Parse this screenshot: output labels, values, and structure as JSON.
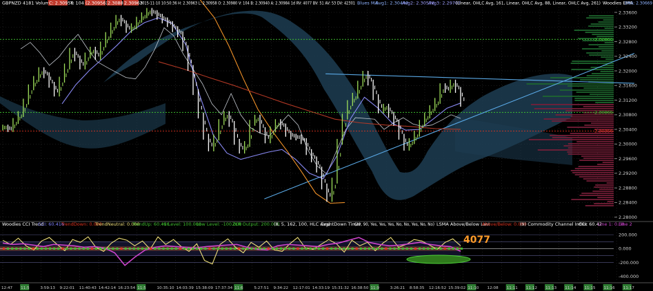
{
  "header": {
    "symbol": "GBPNZD",
    "period": "4181",
    "volume_label": "Volume #2",
    "c_label": "C: 2.30956",
    "t_label": "T: 104",
    "red_badges": [
      "(2.30956)",
      "2.30881",
      "2.30963"
    ],
    "bar_info": "2015-11-10 10:50:36 H: 2.30963 L: 2.30958 O: 2.30980 V: 104 B: 2.30940 A: 2.30984 1d RV: 4077 BV: 51 AV: 53 DV: 42301",
    "blues_ma_label": "Blues MA",
    "avg1": "Avg1: 2.30440",
    "avg2": "Avg2: 2.30576",
    "avg3": "Avg3: 2.29707",
    "ma_params": "(Linear, OHLC Avg, 161, Linear, OHLC Avg, 88, Linear, OHLC Avg, 261)",
    "woodies_ema": "Woodies EMA",
    "ema_value": "EMA: 2.30669"
  },
  "indicator_header": {
    "title": "Woodies CCI Trend",
    "cci": "CCI: 60.416",
    "trend_down": "TrendDown: 0.000",
    "trend_neutral": "TrendNeutral: 0.000",
    "trend_up": "TrendUp: 60.416",
    "hi_level": "Hi Level: 100.000",
    "low_level": "Low Level: -100.000",
    "zlr": "ZLR Output: 200.000",
    "params": "(8, 5, 162, 100, HLC Avg)",
    "countdown": "CountDown Timer",
    "countdown_params": "(20, 90, Yes, Yes, Yes, No, No, Yes, No, No)",
    "lsma": "LSMA Above/Below Last",
    "lsma_value": "Above/Below: 0.000",
    "cci_name": "(9)  Commodity Channel Index",
    "cci2": "CCI: 60.42",
    "line1": "Line 1: 0.00",
    "line2": "Line 2"
  },
  "big_label": "4077",
  "colors": {
    "background": "#000000",
    "grid": "#333333",
    "price_up": "#9fe05a",
    "price_down": "#ffffff",
    "band_fill": "#1d3d52",
    "level_green": "#3fbf2f",
    "level_red": "#e0331f",
    "trendline": "#5aa9e6",
    "cci_line": "#f0e07a",
    "cci_trend": "#cc44cc",
    "big_label": "#ff9c2a",
    "zero_band": "#a0522d"
  },
  "chart_data": [
    {
      "type": "line",
      "title": "",
      "ylim": [
        2.279,
        2.3375
      ],
      "yticks": [
        "2.33600",
        "2.33200",
        "2.32800",
        "2.32400",
        "2.32000",
        "2.31600",
        "2.31200",
        "2.30800",
        "2.30400",
        "2.30000",
        "2.29600",
        "2.29200",
        "2.28800",
        "2.28400",
        "2.28000"
      ],
      "ytick_values": [
        2.336,
        2.332,
        2.328,
        2.324,
        2.32,
        2.316,
        2.312,
        2.308,
        2.304,
        2.3,
        2.296,
        2.292,
        2.288,
        2.284,
        2.28
      ],
      "xticks": [
        "12:47",
        "11:5",
        "3:59:13",
        "9:22:01",
        "11:40:43",
        "14:42:14",
        "16:23:54",
        "11:5",
        "10:35:10",
        "14:03:39",
        "15:38:09",
        "17:37:34",
        "11:6",
        "5:27:51",
        "9:34:22",
        "12:17:01",
        "14:33:19",
        "15:31:32",
        "16:38:50",
        "11:9",
        "3:26:21",
        "8:58:35",
        "12:16:52",
        "15:39:02",
        "11:10",
        "12:08",
        "11:11",
        "11:12",
        "11:13",
        "11:14",
        "11:15",
        "11:16",
        "11:17"
      ],
      "price_labels": [
        {
          "text": "2.32861",
          "value": 2.32861,
          "color": "#3fbf2f"
        },
        {
          "text": "2.30865",
          "value": 2.30865,
          "color": "#3fbf2f"
        },
        {
          "text": "2.30356",
          "value": 2.30356,
          "color": "#e0331f"
        }
      ],
      "horizontal_levels": [
        {
          "value": 2.32861,
          "color": "#3fbf2f"
        },
        {
          "value": 2.30865,
          "color": "#3fbf2f"
        },
        {
          "value": 2.30356,
          "color": "#e0331f"
        }
      ],
      "series": [
        {
          "kind": "price",
          "values": [
            2.3045,
            2.3041,
            2.3063,
            2.3082,
            2.3116,
            2.3155,
            2.3178,
            2.3202,
            2.3188,
            2.3162,
            2.3138,
            2.3176,
            2.3212,
            2.3255,
            2.3234,
            2.3212,
            2.3242,
            2.3258,
            2.3238,
            2.3272,
            2.3298,
            2.3324,
            2.3345,
            2.333,
            2.3312,
            2.3322,
            2.334,
            2.3352,
            2.3364,
            2.3358,
            2.3348,
            2.3338,
            2.3328,
            2.3314,
            2.33,
            2.3262,
            2.3208,
            2.3142,
            2.3078,
            2.302,
            2.2988,
            2.3018,
            2.306,
            2.3082,
            2.3055,
            2.3006,
            2.2982,
            2.3,
            2.3058,
            2.3072,
            2.3038,
            2.301,
            2.304,
            2.306,
            2.3048,
            2.3028,
            2.302,
            2.3018,
            2.3008,
            2.2978,
            2.2958,
            2.293,
            2.2884,
            2.285,
            2.29,
            2.3006,
            2.3075,
            2.3112,
            2.3132,
            2.3165,
            2.3192,
            2.3168,
            2.3128,
            2.3092,
            2.3102,
            2.308,
            2.3058,
            2.302,
            2.299,
            2.3008,
            2.3028,
            2.3058,
            2.3078,
            2.3098,
            2.3118,
            2.3158,
            2.3148,
            2.3168,
            2.3148,
            2.311
          ],
          "color": "#9fe05a"
        },
        {
          "kind": "white-line",
          "values": [
            2.326,
            2.3278,
            2.325,
            2.3215,
            2.3238,
            2.3272,
            2.33,
            2.326,
            2.3225,
            2.321,
            2.3196,
            2.3182,
            2.3178,
            2.321,
            2.3258,
            2.3318,
            2.3296,
            2.3246,
            2.3205,
            2.3165,
            2.311,
            2.308,
            2.3138,
            2.308,
            2.3045,
            2.303,
            2.3022,
            2.3052,
            2.308,
            2.3052,
            2.2985,
            2.294,
            2.2918,
            2.298,
            2.304,
            2.3072,
            2.307,
            2.3068,
            2.304,
            2.3058,
            2.3072,
            2.3055,
            2.3048,
            2.3052,
            2.3065,
            2.308,
            2.307
          ],
          "color": "#cfd4dc"
        },
        {
          "kind": "blue-ma",
          "values": [
            2.311,
            2.3162,
            2.3202,
            2.3235,
            2.327,
            2.3308,
            2.3332,
            2.3345,
            2.333,
            2.3272,
            2.3135,
            2.3025,
            2.2975,
            2.2958,
            2.2968,
            2.2978,
            2.2985,
            2.2958,
            2.292,
            2.2905,
            2.2968,
            2.307,
            2.3128,
            2.3098,
            2.3058,
            2.3038,
            2.304,
            2.3068,
            2.3098,
            2.3112
          ],
          "color": "#8f8fff"
        },
        {
          "kind": "orange-ma",
          "values": [
            2.3395,
            2.3345,
            2.3268,
            2.3178,
            2.3095,
            2.3035,
            2.2982,
            2.2925,
            2.2865,
            2.2838,
            2.284
          ],
          "color": "#ff9a2a"
        },
        {
          "kind": "red-ma",
          "values": [
            2.3225,
            2.3205,
            2.3182,
            2.316,
            2.3136,
            2.3112,
            2.309,
            2.3068,
            2.3058,
            2.3052,
            2.3048,
            2.3042,
            2.304
          ],
          "color": "#b83a26"
        }
      ],
      "trendlines": [
        {
          "from": [
            0.4224,
            2.285
          ],
          "to": [
            1.0,
            2.3248
          ],
          "color": "#5aa9e6"
        },
        {
          "from": [
            0.5285,
            2.3192
          ],
          "to": [
            1.0,
            2.3166
          ],
          "color": "#5aa9e6"
        }
      ]
    },
    {
      "type": "line",
      "title": "Woodies CCI Trend",
      "ylim": [
        -460,
        300
      ],
      "yticks": [
        "200.000",
        "0.000",
        "-200.000",
        "-400.000"
      ],
      "ytick_values": [
        200,
        0,
        -200,
        -400
      ],
      "levels": [
        200,
        100,
        0,
        -100,
        -200
      ],
      "series": [
        {
          "name": "CCI",
          "values": [
            120,
            60,
            150,
            40,
            -20,
            110,
            160,
            60,
            -30,
            130,
            90,
            170,
            20,
            -40,
            80,
            150,
            120,
            40,
            110,
            -10,
            170,
            60,
            130,
            30,
            -40,
            70,
            -170,
            -220,
            60,
            140,
            20,
            -60,
            90,
            20,
            110,
            -20,
            -40,
            70,
            160,
            10,
            -10,
            60,
            130,
            70,
            -50,
            120,
            40,
            90,
            -30,
            80,
            160,
            20,
            60,
            130,
            110,
            50,
            -10,
            90,
            140,
            40
          ],
          "color": "#f0e07a"
        },
        {
          "name": "CCI Trend",
          "values": [
            80,
            60,
            70,
            50,
            30,
            60,
            50,
            40,
            20,
            30,
            10,
            -60,
            -240,
            -120,
            -20,
            20,
            40,
            30,
            20,
            10,
            30,
            40,
            50,
            60,
            20,
            -10,
            -20,
            40,
            60,
            50,
            40,
            30,
            60,
            80,
            120,
            160,
            90,
            60,
            40,
            50,
            70,
            90,
            60,
            40,
            30,
            -40
          ],
          "color": "#cc44cc"
        }
      ]
    }
  ]
}
